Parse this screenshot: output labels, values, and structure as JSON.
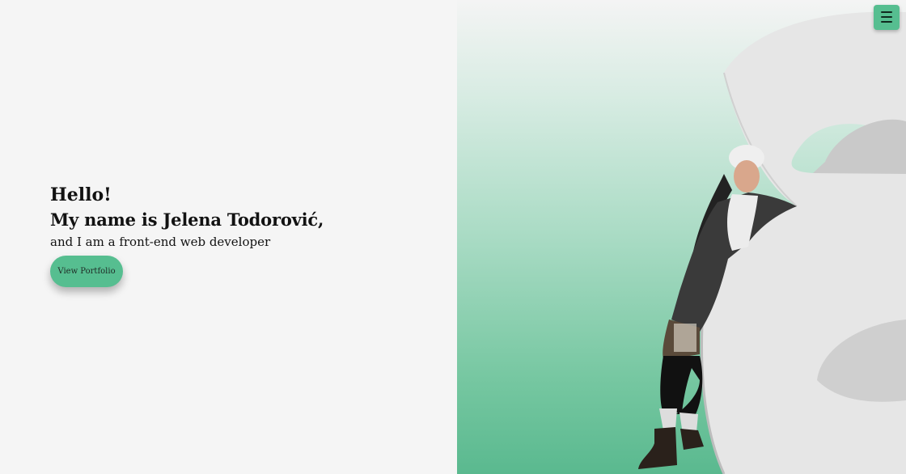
{
  "hero": {
    "greeting": "Hello!",
    "name_line": "My name is Jelena Todorović,",
    "role_line": "and I am a front-end web developer",
    "cta_label": "View Portfolio"
  },
  "nav": {
    "menu_icon": "hamburger-menu-icon"
  },
  "colors": {
    "accent": "#56be90",
    "background": "#f5f5f5",
    "text": "#121212"
  }
}
